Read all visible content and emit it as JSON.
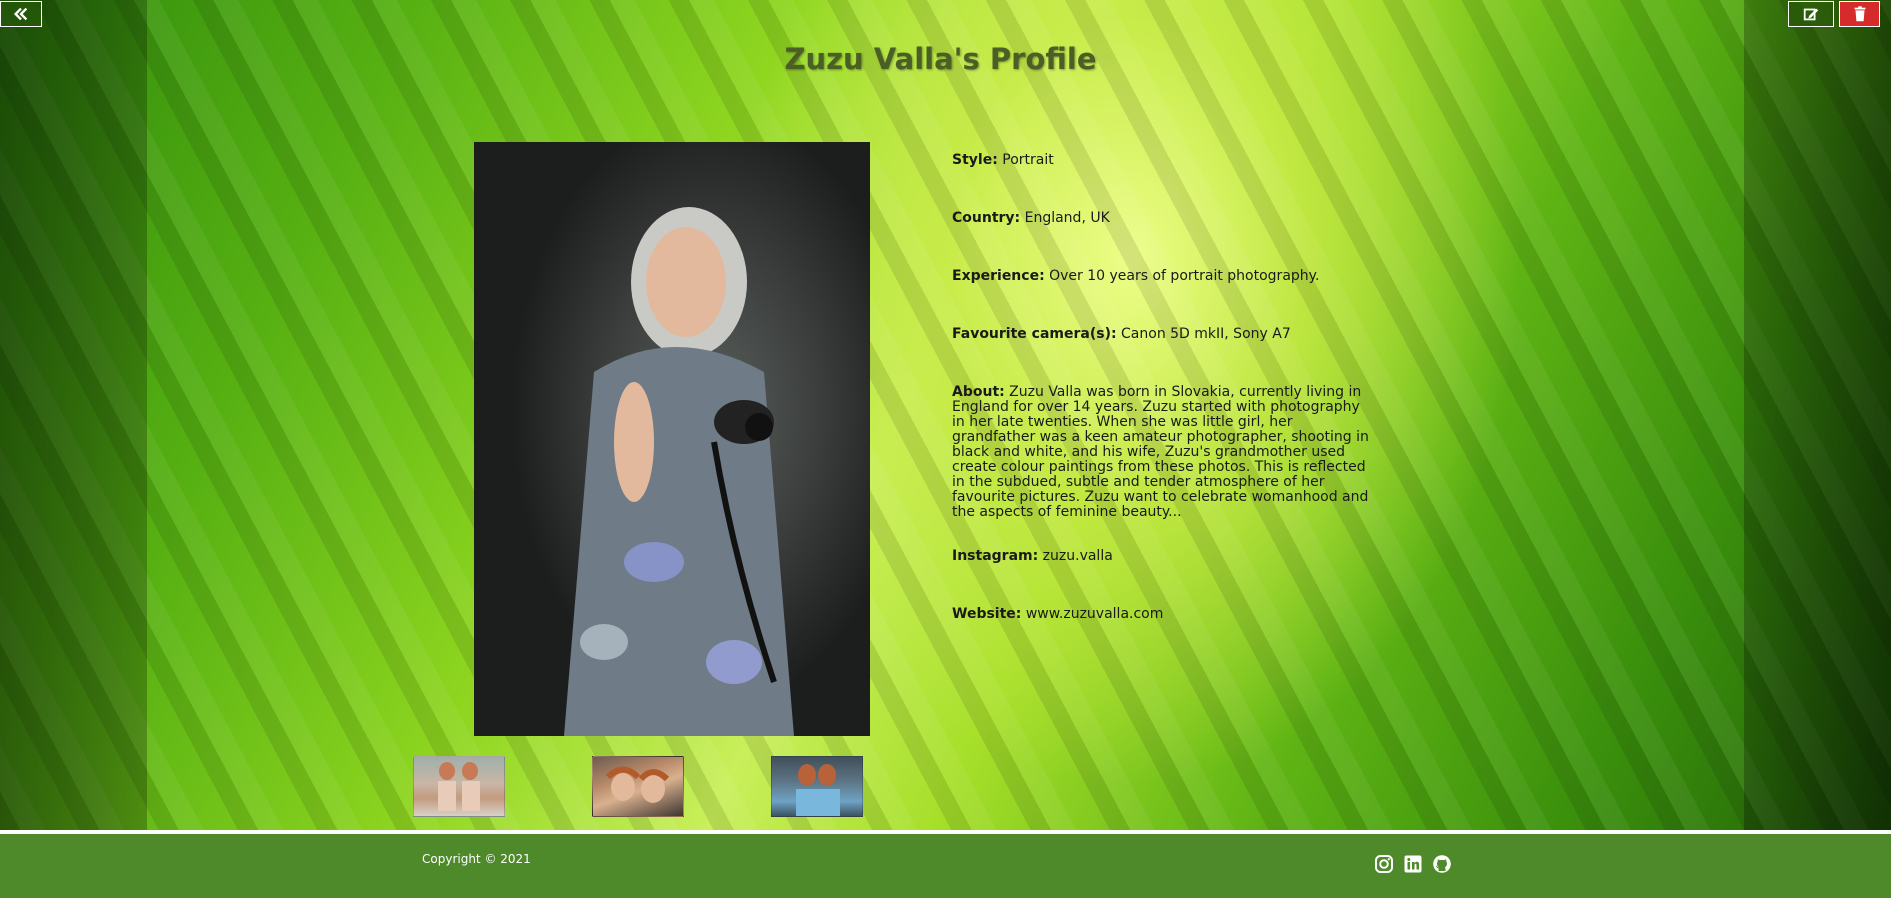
{
  "page": {
    "title": "Zuzu Valla's Profile"
  },
  "toolbar": {
    "back_icon": "double-chevron-left-icon",
    "edit_icon": "edit-icon",
    "delete_icon": "trash-icon"
  },
  "profile": {
    "fields": [
      {
        "label": "Style:",
        "value": " Portrait"
      },
      {
        "label": "Country:",
        "value": " England, UK"
      },
      {
        "label": "Experience:",
        "value": " Over 10 years of portrait photography."
      },
      {
        "label": "Favourite camera(s):",
        "value": " Canon 5D mkII, Sony A7"
      },
      {
        "label": "About:",
        "value": " Zuzu Valla was born in Slovakia, currently living in England for over 14 years. Zuzu started with photography in her late twenties. When she was little girl, her grandfather was a keen amateur photographer, shooting in black and white, and his wife, Zuzu's grandmother used create colour paintings from these photos. This is reflected in the subdued, subtle and tender atmosphere of her favourite pictures. Zuzu want to celebrate womanhood and the aspects of feminine beauty..."
      },
      {
        "label": "Instagram:",
        "value": " zuzu.valla"
      },
      {
        "label": "Website:",
        "value": " www.zuzuvalla.com"
      }
    ]
  },
  "footer": {
    "copyright": "Copyright © 2021",
    "social": [
      "instagram-icon",
      "linkedin-icon",
      "github-icon"
    ]
  },
  "colors": {
    "accent_green": "#4f8a2a",
    "delete_red": "#d62b2b",
    "title": "#4a5f26"
  }
}
